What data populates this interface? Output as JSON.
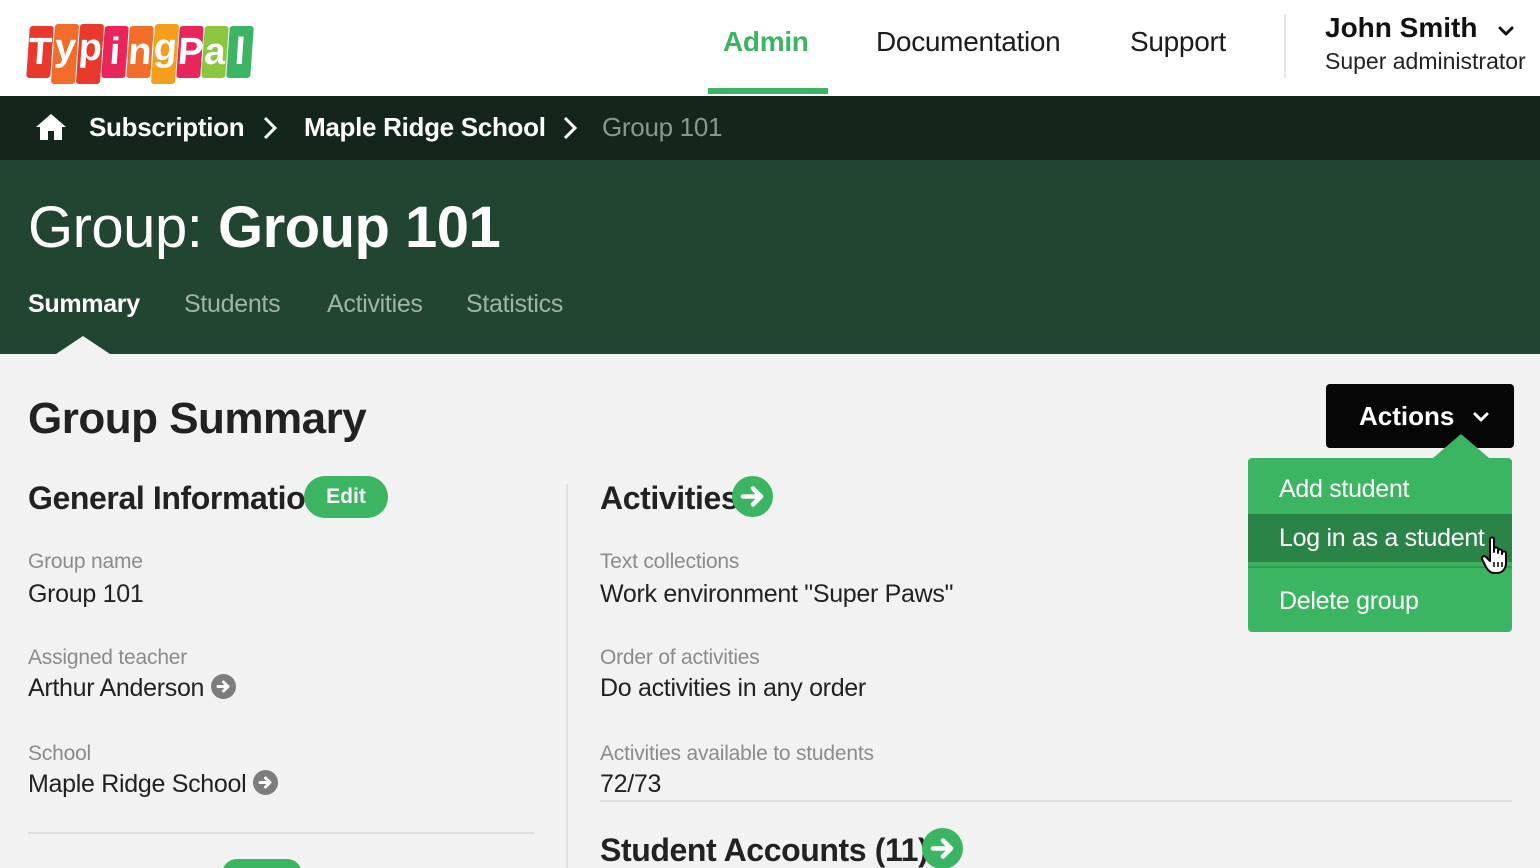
{
  "logo": {
    "letters": [
      "T",
      "y",
      "p",
      "i",
      "n",
      "g",
      "P",
      "a",
      "l"
    ],
    "colors": [
      "#e8392c",
      "#f26c2a",
      "#e8392c",
      "#e9265b",
      "#f26c2a",
      "#f59e1b",
      "#e9265b",
      "#8cc63f",
      "#3bb561"
    ],
    "alt": "TypingPal"
  },
  "nav": {
    "items": [
      {
        "label": "Admin",
        "active": true
      },
      {
        "label": "Documentation",
        "active": false
      },
      {
        "label": "Support",
        "active": false
      }
    ],
    "accent_color": "#3bb561"
  },
  "user": {
    "name": "John Smith",
    "role": "Super administrator"
  },
  "breadcrumb": {
    "home_icon": "home-icon",
    "items": [
      "Subscription",
      "Maple Ridge School",
      "Group 101"
    ]
  },
  "header": {
    "title_prefix": "Group:",
    "title_name": "Group 101",
    "tabs": [
      {
        "label": "Summary",
        "active": true
      },
      {
        "label": "Students",
        "active": false
      },
      {
        "label": "Activities",
        "active": false
      },
      {
        "label": "Statistics",
        "active": false
      }
    ]
  },
  "main": {
    "heading": "Group Summary",
    "general": {
      "heading": "General Information",
      "edit_label": "Edit",
      "fields": [
        {
          "label": "Group name",
          "value": "Group 101",
          "link": false
        },
        {
          "label": "Assigned teacher",
          "value": "Arthur Anderson",
          "link": true
        },
        {
          "label": "School",
          "value": "Maple Ridge School",
          "link": true
        }
      ]
    },
    "activities": {
      "heading": "Activities",
      "fields": [
        {
          "label": "Text collections",
          "value": "Work environment \"Super Paws\""
        },
        {
          "label": "Order of activities",
          "value": "Do activities in any order"
        },
        {
          "label": "Activities available to students",
          "value": "72/73"
        }
      ]
    },
    "student_accounts": {
      "label": "Student Accounts",
      "count": "(11)"
    }
  },
  "actions": {
    "label": "Actions",
    "menu": [
      "Add student",
      "Log in as a student",
      "Delete group"
    ],
    "hovered_index": 1
  }
}
